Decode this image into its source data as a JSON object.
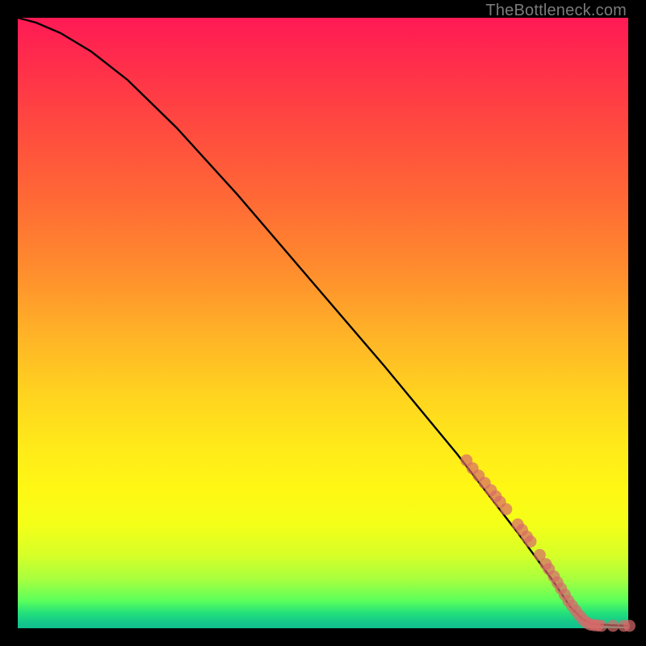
{
  "watermark": "TheBottleneck.com",
  "chart_data": {
    "type": "line",
    "title": "",
    "xlabel": "",
    "ylabel": "",
    "xlim": [
      0,
      100
    ],
    "ylim": [
      0,
      100
    ],
    "grid": false,
    "curve_normalized": [
      [
        0.0,
        100.0
      ],
      [
        3.0,
        99.2
      ],
      [
        7.0,
        97.5
      ],
      [
        12.0,
        94.5
      ],
      [
        18.0,
        89.8
      ],
      [
        26.0,
        82.0
      ],
      [
        36.0,
        71.0
      ],
      [
        48.0,
        57.0
      ],
      [
        60.0,
        43.0
      ],
      [
        72.0,
        28.5
      ],
      [
        82.0,
        15.5
      ],
      [
        87.5,
        8.0
      ],
      [
        90.5,
        3.5
      ],
      [
        92.5,
        1.5
      ],
      [
        94.0,
        0.7
      ],
      [
        97.0,
        0.5
      ],
      [
        100.0,
        0.4
      ]
    ],
    "dots_normalized": [
      [
        73.5,
        27.5
      ],
      [
        74.5,
        26.2
      ],
      [
        75.5,
        25.0
      ],
      [
        76.5,
        23.8
      ],
      [
        77.5,
        22.6
      ],
      [
        78.3,
        21.6
      ],
      [
        79.0,
        20.7
      ],
      [
        80.0,
        19.5
      ],
      [
        81.9,
        17.0
      ],
      [
        82.6,
        16.1
      ],
      [
        83.4,
        15.0
      ],
      [
        84.0,
        14.2
      ],
      [
        85.5,
        12.0
      ],
      [
        86.5,
        10.5
      ],
      [
        87.0,
        9.7
      ],
      [
        87.8,
        8.5
      ],
      [
        88.4,
        7.5
      ],
      [
        89.0,
        6.5
      ],
      [
        89.6,
        5.5
      ],
      [
        90.2,
        4.5
      ],
      [
        90.8,
        3.7
      ],
      [
        91.4,
        2.9
      ],
      [
        92.0,
        2.1
      ],
      [
        92.6,
        1.4
      ],
      [
        93.2,
        0.9
      ],
      [
        93.8,
        0.6
      ],
      [
        94.4,
        0.5
      ],
      [
        95.0,
        0.45
      ],
      [
        95.6,
        0.4
      ],
      [
        97.5,
        0.4
      ],
      [
        99.3,
        0.4
      ],
      [
        100.2,
        0.4
      ]
    ],
    "colors": {
      "curve": "#000000",
      "dots": "#d76a6a"
    }
  }
}
